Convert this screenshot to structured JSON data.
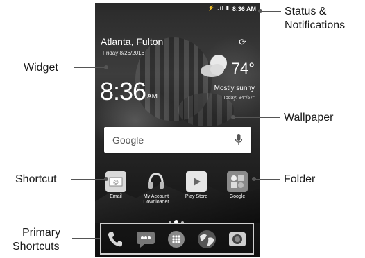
{
  "callouts": {
    "status": "Status &",
    "status2": "Notifications",
    "widget": "Widget",
    "wallpaper": "Wallpaper",
    "shortcut": "Shortcut",
    "folder": "Folder",
    "primary": "Primary",
    "primary2": "Shortcuts"
  },
  "statusbar": {
    "time": "8:36 AM",
    "icons": "⚡ .ıl ▮"
  },
  "weather": {
    "city": "Atlanta, Fulton",
    "date": "Friday 8/26/2016",
    "temperature": "74°",
    "condition": "Mostly sunny",
    "range": "Today: 84°/57°",
    "clock": "8:36",
    "ampm": "AM"
  },
  "search": {
    "logo": "Google"
  },
  "shortcuts": [
    {
      "label": "Email"
    },
    {
      "label": "My Account Downloader"
    },
    {
      "label": "Play Store"
    },
    {
      "label": "Google"
    }
  ],
  "dock": [
    "phone-icon",
    "messages-icon",
    "apps-icon",
    "browser-icon",
    "camera-icon"
  ]
}
